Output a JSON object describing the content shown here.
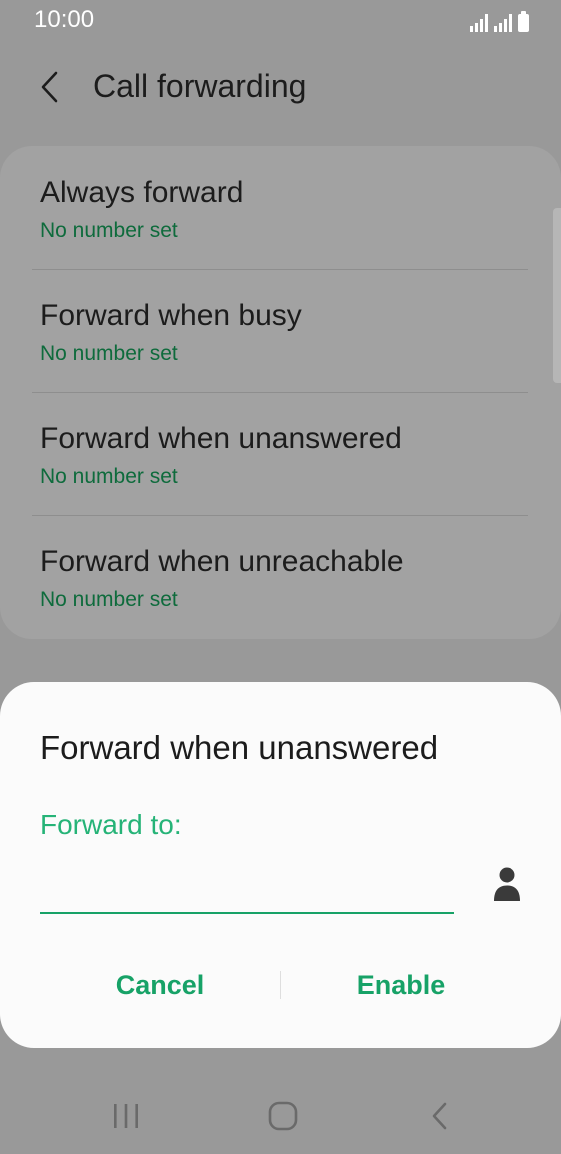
{
  "status_bar": {
    "time": "10:00"
  },
  "app_bar": {
    "title": "Call forwarding"
  },
  "call_forwarding_options": [
    {
      "title": "Always forward",
      "summary": "No number set"
    },
    {
      "title": "Forward when busy",
      "summary": "No number set"
    },
    {
      "title": "Forward when unanswered",
      "summary": "No number set"
    },
    {
      "title": "Forward when unreachable",
      "summary": "No number set"
    }
  ],
  "dialog": {
    "title": "Forward when unanswered",
    "field_label": "Forward to:",
    "input_value": "",
    "cancel_label": "Cancel",
    "enable_label": "Enable"
  },
  "icons": {
    "back": "chevron-left-icon",
    "contact": "person-icon",
    "signal": "signal-icon",
    "battery": "battery-icon",
    "nav_recents": "recents-icon",
    "nav_home": "home-icon",
    "nav_back": "back-icon"
  },
  "colors": {
    "accent": "#17a267",
    "label_accent": "#25b377",
    "summary": "#0e6b3c",
    "scrim": "#999999",
    "dialog_bg": "#fbfbfb"
  }
}
